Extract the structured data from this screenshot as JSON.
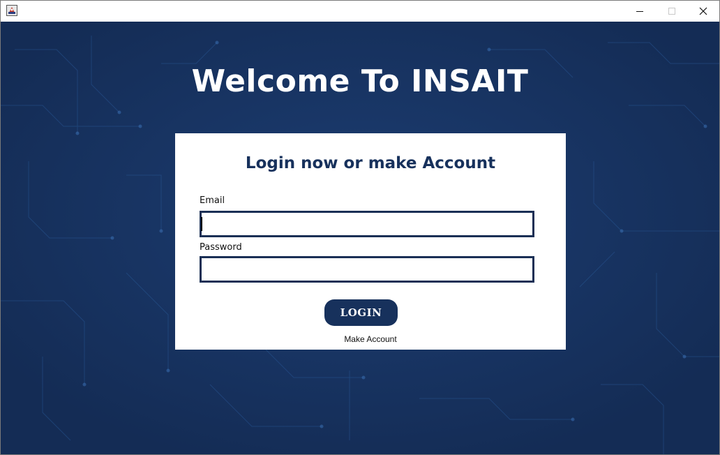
{
  "window": {
    "icon": "java-app-icon",
    "controls": {
      "minimize": "minimize-icon",
      "maximize": "maximize-icon",
      "close": "close-icon"
    }
  },
  "main": {
    "heading": "Welcome To INSAIT"
  },
  "login_card": {
    "title": "Login now or make Account",
    "email_label": "Email",
    "email_value": "",
    "password_label": "Password",
    "password_value": "",
    "login_button": "LOGIN",
    "make_account_link": "Make Account"
  },
  "colors": {
    "background": "#183462",
    "accent": "#17315c",
    "card": "#ffffff"
  }
}
